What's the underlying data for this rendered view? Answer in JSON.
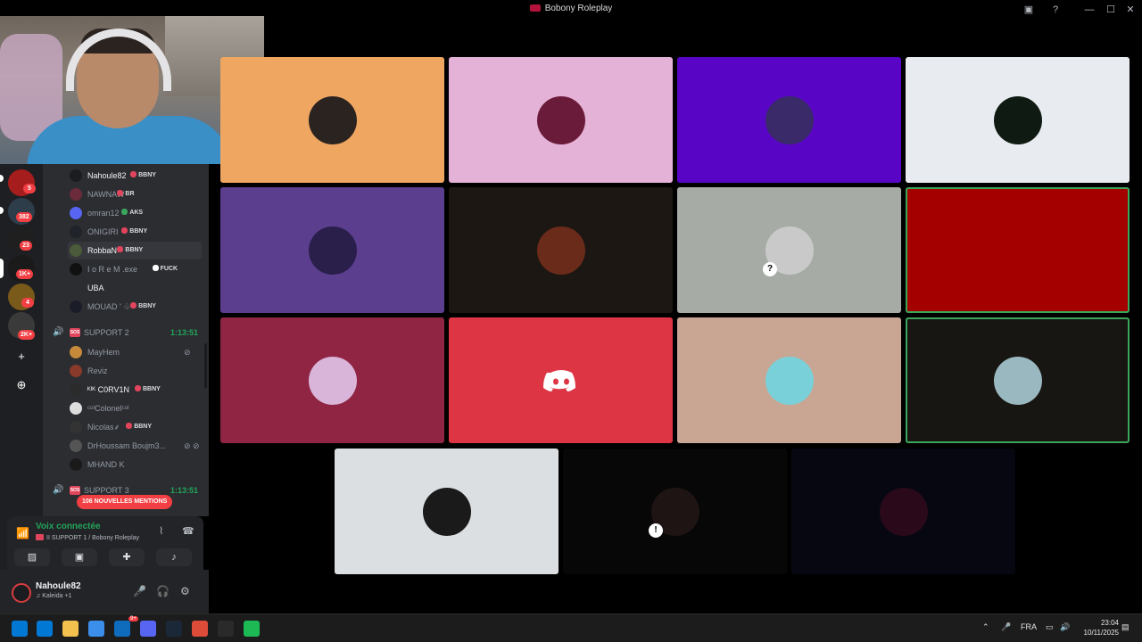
{
  "window": {
    "title": "Bobony Roleplay",
    "buttons": {
      "inbox": "▣",
      "help": "?",
      "minimize": "—",
      "maximize": "☐",
      "close": "✕"
    }
  },
  "rail": {
    "badges": [
      "5",
      "382",
      "23",
      "1K+",
      "4",
      "2K+"
    ],
    "add_label": "+",
    "discover_label": "⊕",
    "server_colors": [
      "#a51d1d",
      "#2e3d4a",
      "#1f1f1f",
      "#1a1a1a",
      "#7a5a1a",
      "#3a3a3a"
    ]
  },
  "channels": {
    "members_top": [
      {
        "name": "Nahoule82",
        "tag": "BBNY",
        "bright": true,
        "avatar": "#1b1c1f"
      },
      {
        "name": "NAWNAW",
        "tag": "BR",
        "avatar": "#6b2b3a"
      },
      {
        "name": "omran12",
        "tag": "AKS",
        "tag_color": "green",
        "avatar": "#5865f2"
      },
      {
        "name": "ONIGIRI",
        "tag": "BBNY",
        "avatar": "#20232a"
      },
      {
        "name": "RobbaN",
        "tag": "BBNY",
        "bright": true,
        "highlight": true,
        "avatar": "#4a5a3a"
      },
      {
        "name": "I o R e M .exe",
        "tag": "FUCK",
        "tag_color": "white",
        "avatar": "#111"
      },
      {
        "name": "UBA",
        "avatar": "#2b2d31",
        "bright": true
      },
      {
        "name": "MOUAD ' ♧",
        "tag": "BBNY",
        "avatar": "#1a1d28"
      }
    ],
    "channel_support2": {
      "name": "SUPPORT 2",
      "time": "1:13:51",
      "sos": "SOS"
    },
    "members_support2": [
      {
        "name": "MayHem",
        "icon": "⊘",
        "avatar": "#c68a3a"
      },
      {
        "name": "Reviz",
        "avatar": "#8a3a2a"
      },
      {
        "name": "ᴷᴵᴷ C0RV1N",
        "tag": "BBNY",
        "bright": true,
        "avatar": "#2b2b2b"
      },
      {
        "name": "ᶜᵒˡColonelᶜᵒˡ",
        "avatar": "#ddd"
      },
      {
        "name": "Nicolas⸙",
        "tag": "BBNY",
        "avatar": "#333"
      },
      {
        "name": "DrHoussam Boujm3...",
        "icon": "⊘ ⊘",
        "avatar": "#555"
      },
      {
        "name": "MHAND K",
        "avatar": "#1a1a1a"
      }
    ],
    "channel_support3": {
      "name": "SUPPORT 3",
      "time": "1:13:51",
      "sos": "SOS"
    },
    "mentions_banner": "106 NOUVELLES MENTIONS"
  },
  "voice_panel": {
    "status": "Voix connectée",
    "channel": "II SUPPORT 1 / Bobony Roleplay",
    "buttons": {
      "noise": "⌇",
      "disconnect": "☎",
      "camera": "▨",
      "screen": "▣",
      "activities": "✚",
      "soundboard": "♪"
    }
  },
  "user_panel": {
    "name": "Nahoule82",
    "status": "♫ Kaleida +1",
    "buttons": {
      "mic": "🎤",
      "headset": "🎧",
      "settings": "⚙"
    }
  },
  "tiles": [
    {
      "bg": "#efa661",
      "avatar": "#2a2320"
    },
    {
      "bg": "#e4b1d7",
      "avatar": "#6b1b3a"
    },
    {
      "bg": "#5805c6",
      "avatar": "#3a2a6a"
    },
    {
      "bg": "#e8ebef",
      "avatar": "#0e1a12"
    },
    {
      "bg": "#5b3e8e",
      "avatar": "#2a1e4a"
    },
    {
      "bg": "#1c1712",
      "avatar": "#6a2b1a"
    },
    {
      "bg": "#a6aca5",
      "avatar": "#c9c9c9",
      "qmark": "?"
    },
    {
      "bg": "#a40000",
      "avatar": "#a40000",
      "speaking": true
    },
    {
      "bg": "#8f2542",
      "avatar": "#d9b5d9"
    },
    {
      "bg": "#de3544",
      "avatar": "#de3544",
      "discord": true
    },
    {
      "bg": "#c9a693",
      "avatar": "#7ad0d8"
    },
    {
      "bg": "#181612",
      "avatar": "#9ab8c0",
      "speaking": true
    },
    {
      "bg": "#dcdfe1",
      "avatar": "#1a1a1a"
    },
    {
      "bg": "#070707",
      "avatar": "#1f1414",
      "qmark": "!"
    },
    {
      "bg": "#070712",
      "avatar": "#2a0a1a"
    }
  ],
  "taskbar": {
    "lang": "FRA",
    "time": "23:04",
    "date": "10/11/2025",
    "badge": "9+",
    "app_colors": [
      "#0078d4",
      "#f2c14e",
      "#3b8eea",
      "#0f6cbd",
      "#5865f2",
      "#1b2838",
      "#dd4b39",
      "#2a2a2a",
      "#1db954"
    ]
  }
}
